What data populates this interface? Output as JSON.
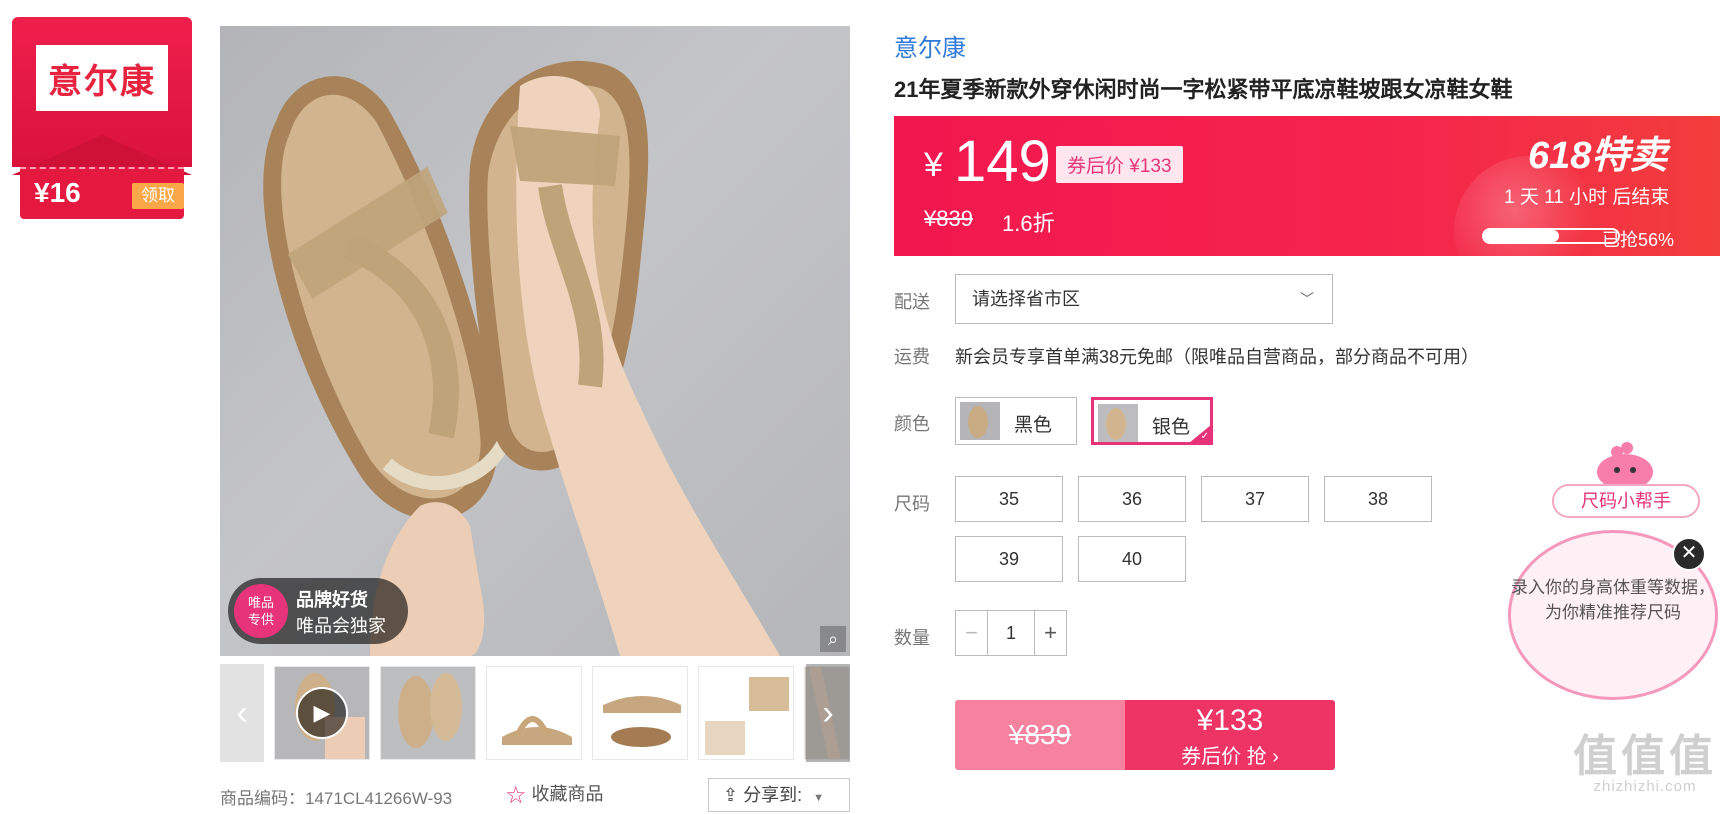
{
  "brand_coupon": {
    "logo_text": "意尔康",
    "amount": "¥16",
    "claim_label": "领取"
  },
  "main_image": {
    "badge_circle": "唯品\n专供",
    "badge_line1": "品牌好货",
    "badge_line2": "唯品会独家",
    "zoom_icon": "zoom-icon"
  },
  "thumbnails": {
    "prev_icon": "‹",
    "next_icon": "›",
    "count": 6,
    "play_icon": "▶"
  },
  "meta": {
    "product_code": "商品编码：1471CL41266W-93",
    "favorite_label": "收藏商品",
    "share_label": "分享到:"
  },
  "product": {
    "brand": "意尔康",
    "title": "21年夏季新款外穿休闲时尚一字松紧带平底凉鞋坡跟女凉鞋女鞋"
  },
  "price_banner": {
    "currency": "¥",
    "price": "149",
    "coupon_price": "券后价 ¥133",
    "original_price": "¥839",
    "discount": "1.6折",
    "promo_title": "618特卖",
    "countdown": "1 天 11 小时 后结束",
    "sold_percent": 56,
    "sold_label": "已抢56%"
  },
  "delivery": {
    "label": "配送",
    "placeholder": "请选择省市区"
  },
  "shipping": {
    "label": "运费",
    "text": "新会员专享首单满38元免邮（限唯品自营商品，部分商品不可用）"
  },
  "color": {
    "label": "颜色",
    "options": [
      "黑色",
      "银色"
    ],
    "selected": "银色"
  },
  "size": {
    "label": "尺码",
    "options": [
      "35",
      "36",
      "37",
      "38",
      "39",
      "40"
    ]
  },
  "quantity": {
    "label": "数量",
    "value": "1",
    "minus": "−",
    "plus": "+"
  },
  "buy": {
    "original_price": "¥839",
    "price": "¥133",
    "action": "券后价 抢 ›"
  },
  "size_helper": {
    "title": "尺码小帮手",
    "message": "录入你的身高体重等数据，为你精准推荐尺码",
    "close": "✕"
  },
  "watermark": {
    "big": "值值值",
    "small": "zhizhizhi.com"
  },
  "colors": {
    "accent": "#e6337a",
    "banner": "#f2174f",
    "link": "#2f7ad8"
  }
}
